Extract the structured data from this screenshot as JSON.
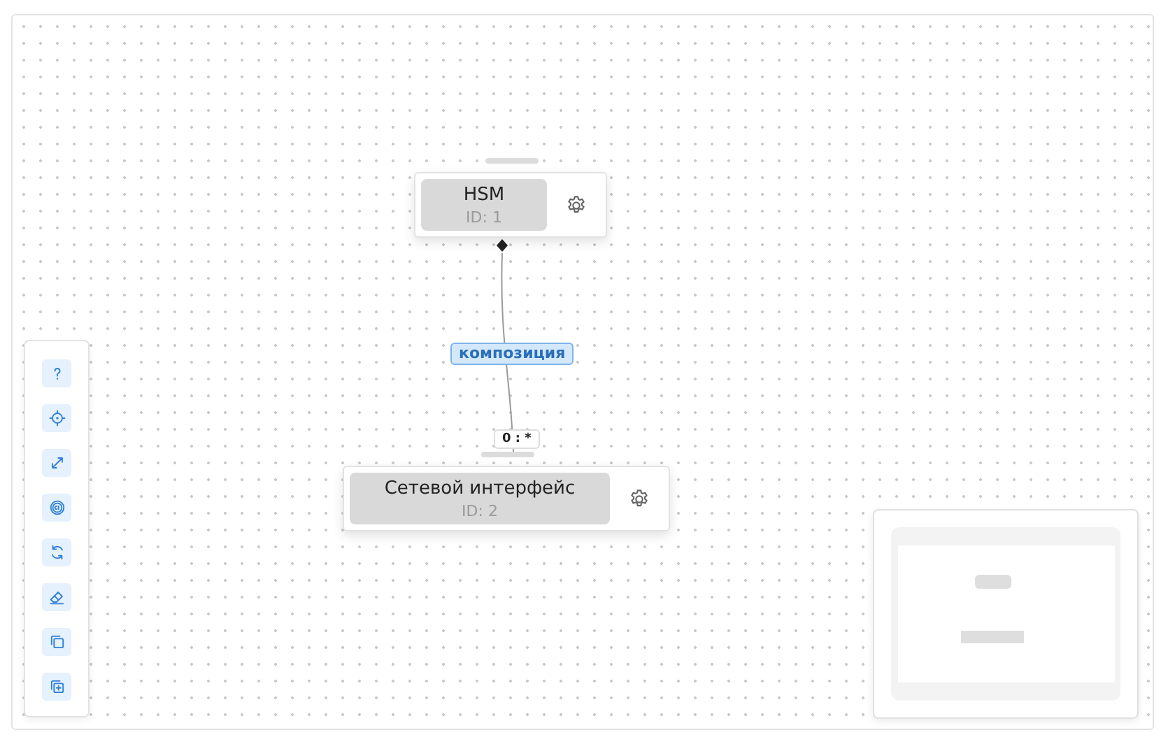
{
  "nodes": [
    {
      "title": "HSM",
      "id_label": "ID: 1"
    },
    {
      "title": "Сетевой интерфейс",
      "id_label": "ID: 2"
    }
  ],
  "edges": [
    {
      "label": "композиция",
      "multiplicity": "0 : *"
    }
  ]
}
